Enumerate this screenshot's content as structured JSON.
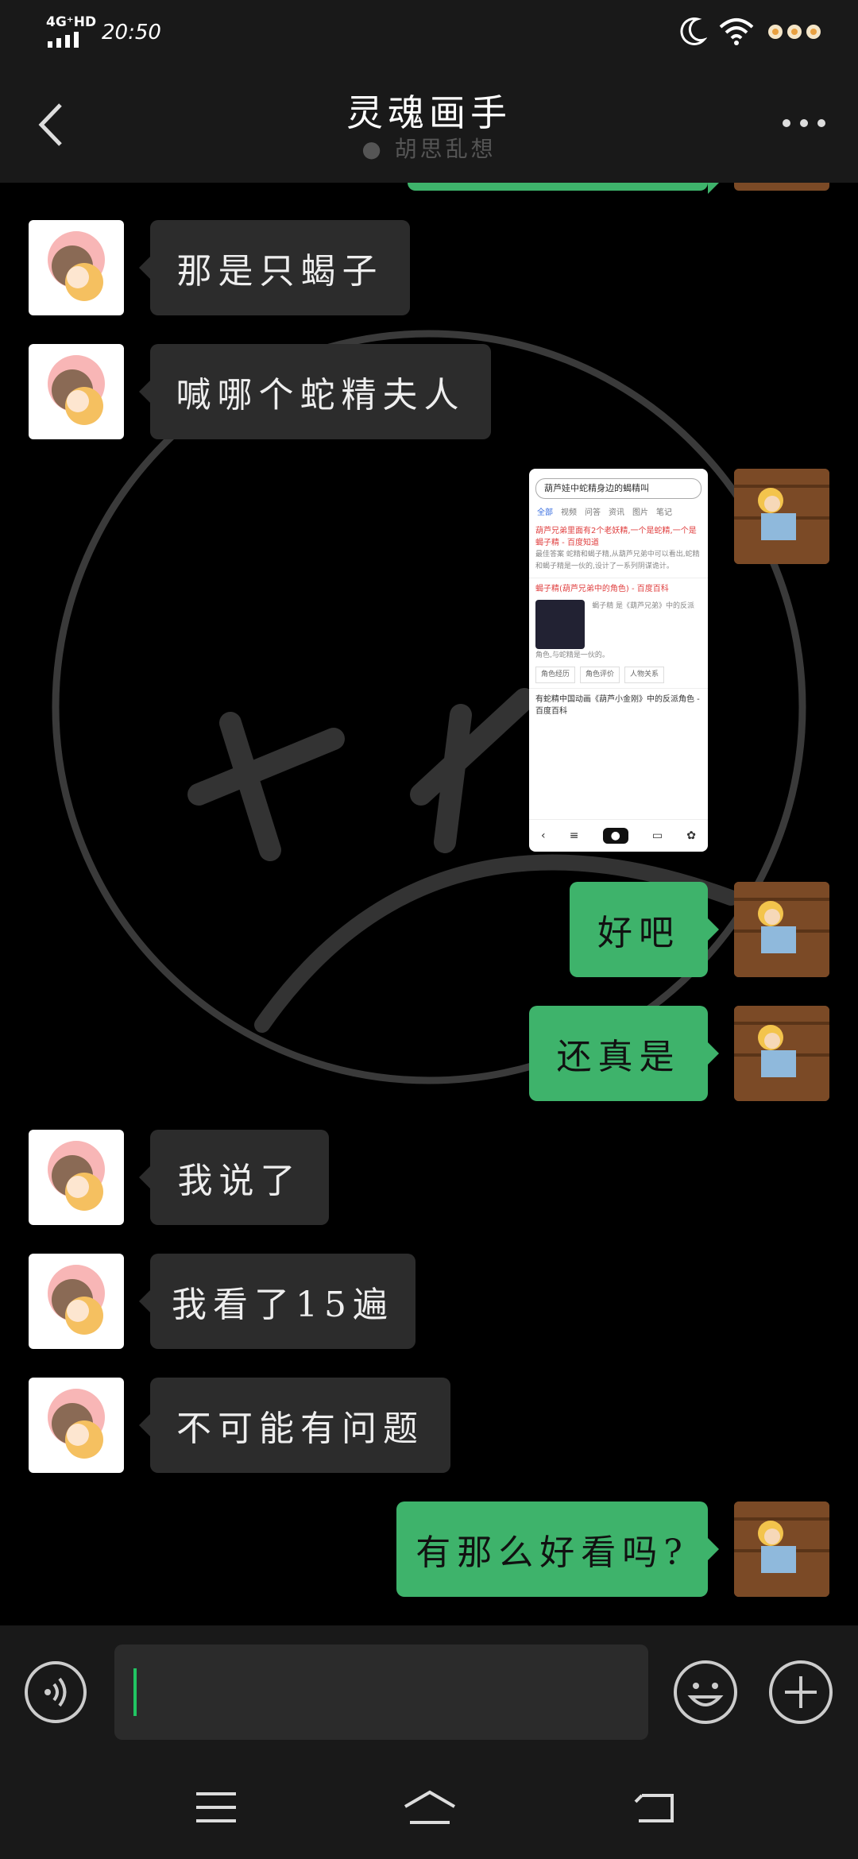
{
  "status_bar": {
    "network": "4G⁺HD",
    "time": "20:50"
  },
  "header": {
    "title": "灵魂画手",
    "subtitle": "胡思乱想"
  },
  "messages": [
    {
      "side": "left",
      "text": "那是只蝎子"
    },
    {
      "side": "left",
      "text": "喊哪个蛇精夫人"
    },
    {
      "side": "right",
      "type": "image",
      "text": ""
    },
    {
      "side": "right",
      "text": "好吧"
    },
    {
      "side": "right",
      "text": "还真是"
    },
    {
      "side": "left",
      "text": "我说了"
    },
    {
      "side": "left",
      "text": "我看了15遍"
    },
    {
      "side": "left",
      "text": "不可能有问题"
    },
    {
      "side": "right",
      "text": "有那么好看吗?"
    }
  ],
  "screenshot_preview": {
    "search": "葫芦娃中蛇精身边的蝎精叫",
    "tabs": [
      "全部",
      "视频",
      "问答",
      "资讯",
      "图片",
      "笔记"
    ],
    "result1_title": "葫芦兄弟里面有2个老妖精,一个是蛇精,一个是蝎子精 - 百度知道",
    "result1_body": "最佳答案 蛇精和蝎子精,从葫芦兄弟中可以看出,蛇精和蝎子精是一伙的,设计了一系列阴谋诡计。",
    "result2_title": "蝎子精(葫芦兄弟中的角色) - 百度百科",
    "result2_body": "蝎子精 是《葫芦兄弟》中的反派角色,与蛇精是一伙的。",
    "result2_chips": [
      "角色经历",
      "角色评价",
      "人物关系"
    ],
    "result3_title": "有蛇精中国动画《葫芦小金刚》中的反派角色 - 百度百科"
  },
  "colors": {
    "self_bubble": "#3eb36b",
    "other_bubble": "#2c2c2c",
    "bar_bg": "#191919"
  }
}
